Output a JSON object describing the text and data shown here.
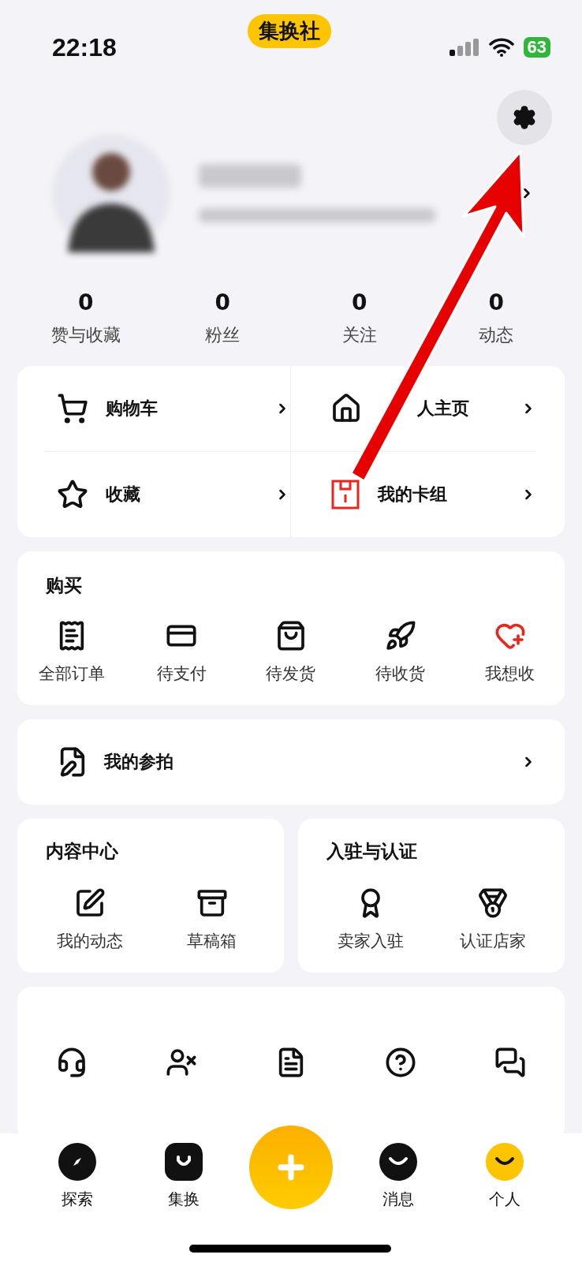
{
  "status_bar": {
    "time": "22:18",
    "app_badge": "集换社",
    "battery": "63"
  },
  "stats": [
    {
      "value": "0",
      "label": "赞与收藏"
    },
    {
      "value": "0",
      "label": "粉丝"
    },
    {
      "value": "0",
      "label": "关注"
    },
    {
      "value": "0",
      "label": "动态"
    }
  ],
  "shortcuts": [
    {
      "label": "购物车"
    },
    {
      "label": "人主页"
    },
    {
      "label": "收藏"
    },
    {
      "label": "我的卡组"
    }
  ],
  "purchase": {
    "title": "购买",
    "items": [
      {
        "label": "全部订单"
      },
      {
        "label": "待支付"
      },
      {
        "label": "待发货"
      },
      {
        "label": "待收货"
      },
      {
        "label": "我想收"
      }
    ]
  },
  "auction": {
    "label": "我的参拍"
  },
  "content_center": {
    "title": "内容中心",
    "items": [
      {
        "label": "我的动态"
      },
      {
        "label": "草稿箱"
      }
    ]
  },
  "certification": {
    "title": "入驻与认证",
    "items": [
      {
        "label": "卖家入驻"
      },
      {
        "label": "认证店家"
      }
    ]
  },
  "tab_bar": [
    {
      "label": "探索",
      "selected": false
    },
    {
      "label": "集换",
      "selected": false
    },
    {
      "kind": "plus",
      "selected": false
    },
    {
      "label": "消息",
      "selected": false
    },
    {
      "label": "个人",
      "selected": true
    }
  ]
}
